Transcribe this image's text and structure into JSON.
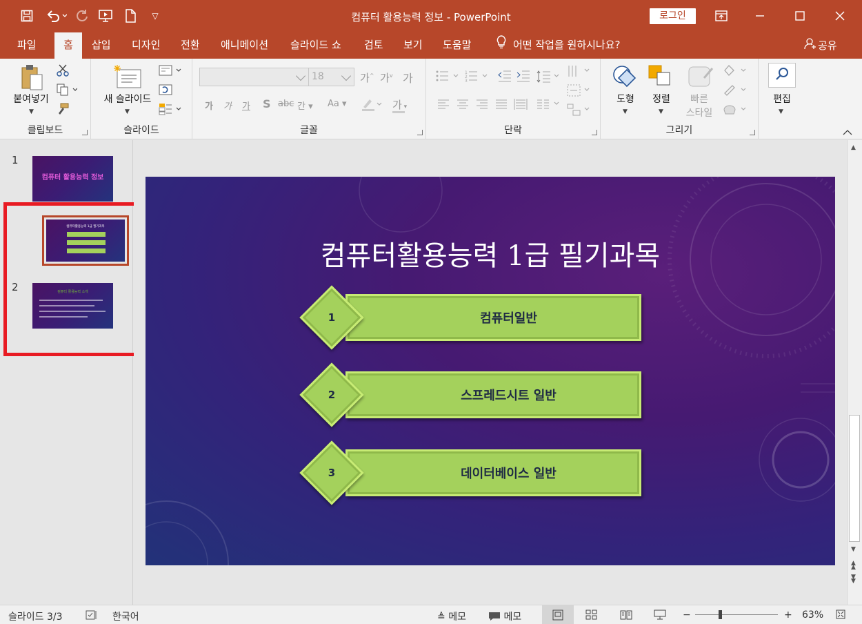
{
  "window": {
    "title": "컴퓨터 활용능력 정보  -  PowerPoint",
    "login_label": "로그인"
  },
  "tabs": [
    "파일",
    "홈",
    "삽입",
    "디자인",
    "전환",
    "애니메이션",
    "슬라이드 쇼",
    "검토",
    "보기",
    "도움말"
  ],
  "active_tab": "홈",
  "tell_me": "어떤 작업을 원하시나요?",
  "share": "공유",
  "ribbon": {
    "clipboard": {
      "paste": "붙여넣기",
      "label": "클립보드"
    },
    "slides": {
      "new_slide": "새 슬라이드",
      "label": "슬라이드"
    },
    "font": {
      "size": "18",
      "label": "글꼴"
    },
    "paragraph": {
      "label": "단락"
    },
    "drawing": {
      "shapes": "도형",
      "arrange": "정렬",
      "quick_styles_1": "빠른",
      "quick_styles_2": "스타일",
      "label": "그리기"
    },
    "editing": {
      "label": "편집"
    }
  },
  "thumbnails": [
    {
      "num": "1",
      "title": "컴퓨터 활용능력 정보"
    },
    {
      "num": "",
      "title": "컴퓨터활용능력 1급 필기과목"
    },
    {
      "num": "2",
      "title": "컴퓨터 활용능력 소개"
    }
  ],
  "slide": {
    "title": "컴퓨터활용능력 1급 필기과목",
    "items": [
      {
        "num": "1",
        "label": "컴퓨터일반"
      },
      {
        "num": "2",
        "label": "스프레드시트 일반"
      },
      {
        "num": "3",
        "label": "데이터베이스 일반"
      }
    ]
  },
  "status": {
    "slide_counter": "슬라이드 3/3",
    "language": "한국어",
    "notes": "메모",
    "comments": "메모",
    "zoom_pct": "63%",
    "zoom_level": 0.63
  }
}
